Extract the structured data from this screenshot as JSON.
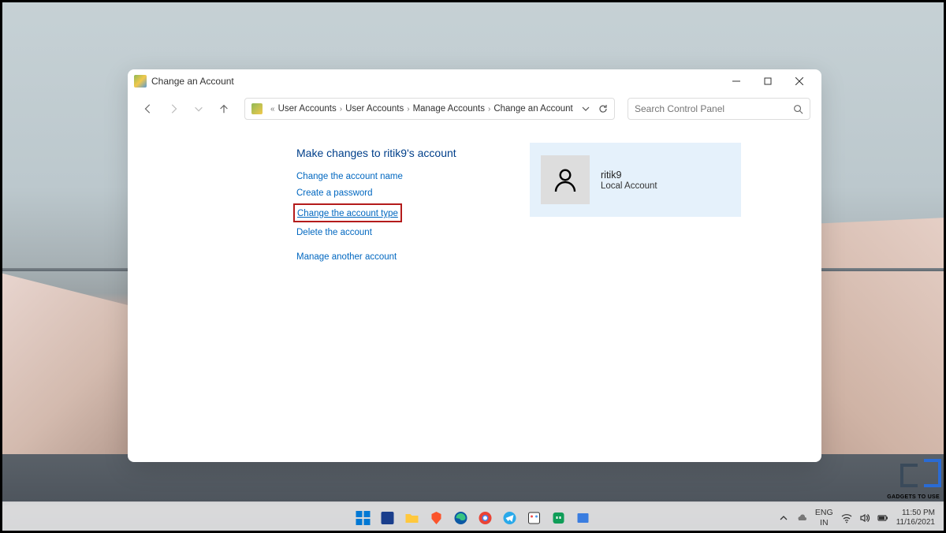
{
  "window": {
    "title": "Change an Account",
    "breadcrumbs": [
      "User Accounts",
      "User Accounts",
      "Manage Accounts",
      "Change an Account"
    ],
    "search_placeholder": "Search Control Panel"
  },
  "page": {
    "heading": "Make changes to ritik9's account",
    "actions": {
      "change_name": "Change the account name",
      "create_password": "Create a password",
      "change_type": "Change the account type",
      "delete_account": "Delete the account",
      "manage_another": "Manage another account"
    }
  },
  "account": {
    "name": "ritik9",
    "type": "Local Account"
  },
  "taskbar": {
    "lang_top": "ENG",
    "lang_bottom": "IN",
    "time": "11:50 PM",
    "date": "11/16/2021"
  },
  "watermark": "GADGETS TO USE"
}
